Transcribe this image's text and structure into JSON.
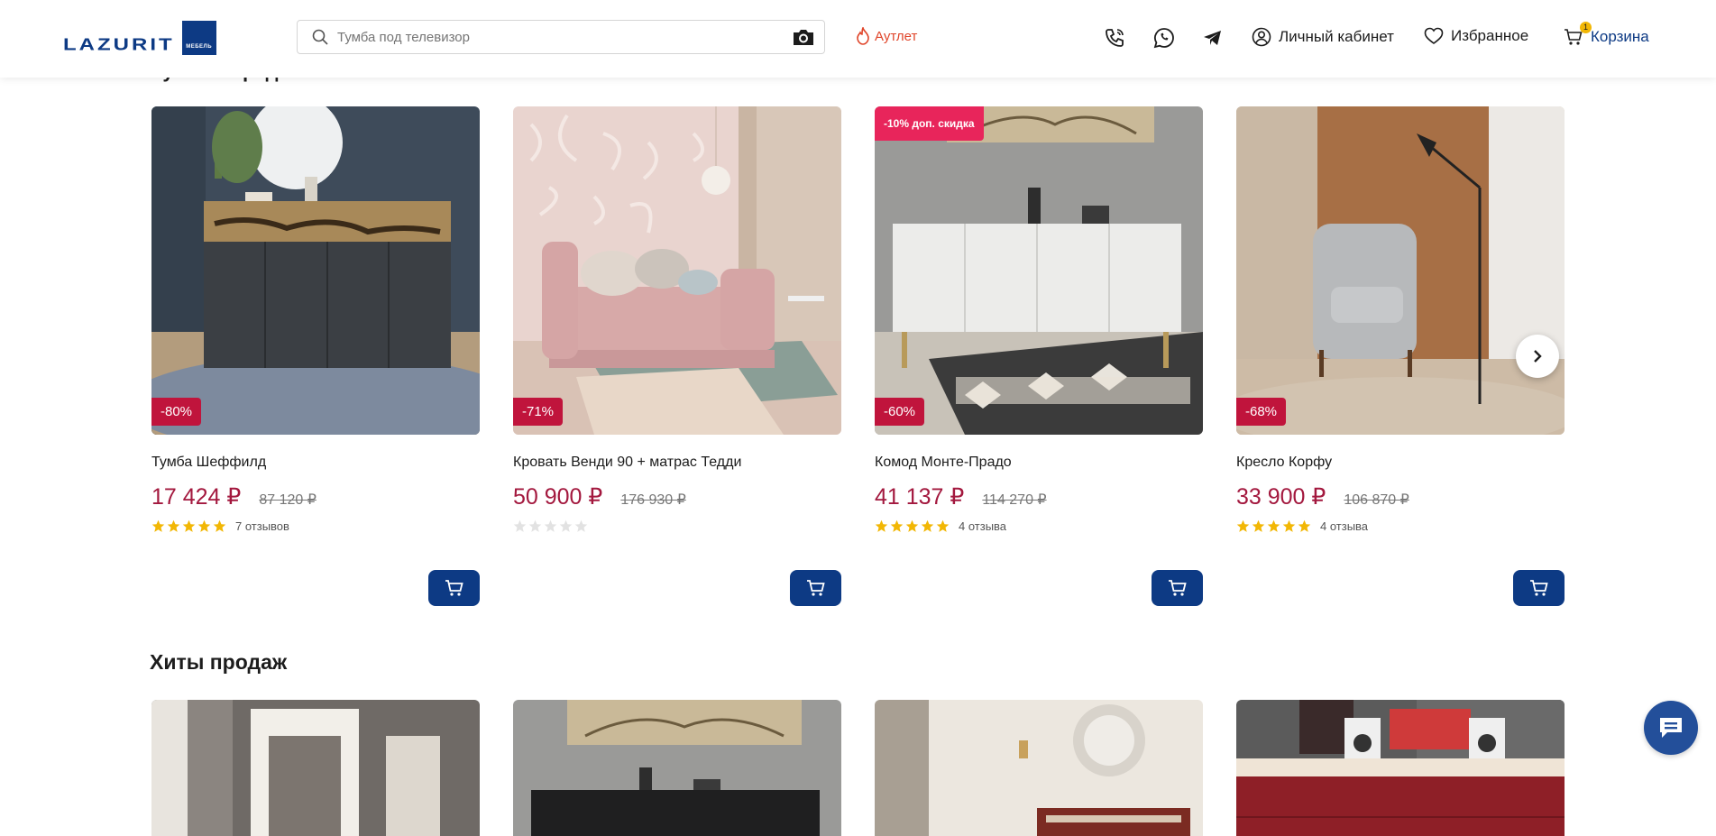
{
  "header": {
    "logo_text": "LAZURIT",
    "logo_sub": "МЕБЕЛЬ",
    "search_placeholder": "Тумба под телевизор",
    "outlet_label": "Аутлет",
    "account_label": "Личный кабинет",
    "favorites_label": "Избранное",
    "cart_label": "Корзина",
    "cart_count": "1"
  },
  "section_top": {
    "title": "Лучшие предложения"
  },
  "products": [
    {
      "title": "Тумба Шеффилд",
      "price": "17 424 ₽",
      "old_price": "87 120 ₽",
      "discount": "-80%",
      "extra_badge": "",
      "rating": 5,
      "reviews": "7 отзывов"
    },
    {
      "title": "Кровать Венди 90 + матрас Тедди",
      "price": "50 900 ₽",
      "old_price": "176 930 ₽",
      "discount": "-71%",
      "extra_badge": "",
      "rating": 0,
      "reviews": ""
    },
    {
      "title": "Комод Монте-Прадо",
      "price": "41 137 ₽",
      "old_price": "114 270 ₽",
      "discount": "-60%",
      "extra_badge": "-10% доп. скидка",
      "rating": 5,
      "reviews": "4 отзыва"
    },
    {
      "title": "Кресло Корфу",
      "price": "33 900 ₽",
      "old_price": "106 870 ₽",
      "discount": "-68%",
      "extra_badge": "",
      "rating": 5,
      "reviews": "4 отзыва"
    }
  ],
  "hits": {
    "title": "Хиты продаж"
  },
  "colors": {
    "brand_blue": "#0d3a84",
    "price_red": "#a3183e",
    "badge_red": "#c0143c",
    "outlet_orange": "#e0452a",
    "star_yellow": "#f2b705"
  },
  "icons": {
    "search": "search-icon",
    "camera": "camera-icon",
    "outlet": "flame-icon",
    "phone": "phone-icon",
    "whatsapp": "whatsapp-icon",
    "telegram": "telegram-icon",
    "account": "user-icon",
    "favorites": "heart-icon",
    "cart": "cart-icon",
    "next": "chevron-right-icon",
    "chat": "chat-icon"
  }
}
